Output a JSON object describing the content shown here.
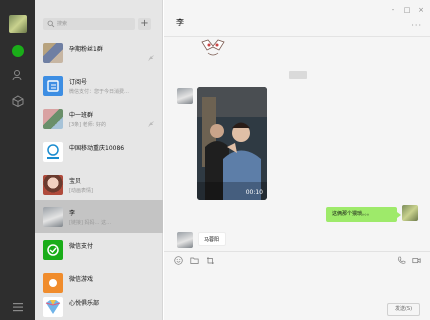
{
  "window": {
    "minimize_glyph": "-",
    "maximize_glyph": "□",
    "close_glyph": "×"
  },
  "sidebar": {
    "icons": [
      "user-avatar",
      "chat-icon",
      "contacts-icon",
      "favorites-icon",
      "menu-icon"
    ]
  },
  "search": {
    "placeholder": "搜索",
    "add_label": "+"
  },
  "chat_list": [
    {
      "name": "孕期粉丝1群",
      "preview": "",
      "time": "",
      "muted": true
    },
    {
      "name": "订阅号",
      "preview": "微信支付：您于今日消费…",
      "time": "",
      "muted": false
    },
    {
      "name": "中一班群",
      "preview": "[3条] 老师: 好的",
      "time": "",
      "muted": true
    },
    {
      "name": "中国移动重庆10086",
      "preview": "",
      "time": "",
      "muted": false
    },
    {
      "name": "宝贝",
      "preview": "[动画表情]",
      "time": "",
      "muted": false
    },
    {
      "name": "李",
      "preview": "[链接] 妈妈…  这…",
      "time": "",
      "muted": false,
      "active": true
    },
    {
      "name": "微信支付",
      "preview": "",
      "time": "",
      "muted": false
    },
    {
      "name": "微信游戏",
      "preview": "",
      "time": "",
      "muted": false
    },
    {
      "name": "心悦俱乐部",
      "preview": "",
      "time": "",
      "muted": false
    }
  ],
  "conversation": {
    "title": "李",
    "more_label": "···",
    "video_duration": "00:10",
    "sent_message": "这俩那个猥琐。。。",
    "received_message": "马蓉阳",
    "send_label": "发送(S)"
  },
  "colors": {
    "rail": "#2e2e2e",
    "list_bg": "#e6e6e6",
    "active_item": "#c4c4c4",
    "panel_bg": "#f5f5f5",
    "sent_bubble": "#9eea6a",
    "accent_green": "#1aad19"
  }
}
